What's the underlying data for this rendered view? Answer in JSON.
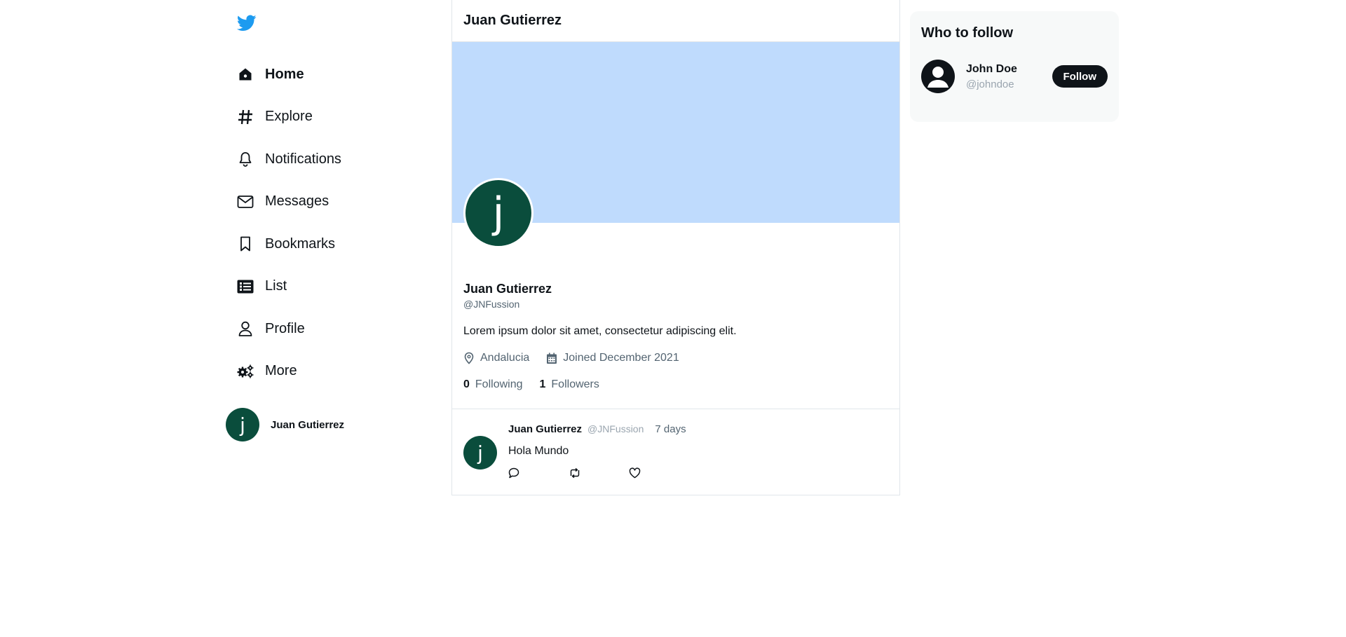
{
  "brand": {
    "color": "#1d9bf0",
    "icon": "twitter-bird-icon"
  },
  "sidebar": {
    "items": [
      {
        "label": "Home",
        "icon": "home-icon",
        "active": true
      },
      {
        "label": "Explore",
        "icon": "hashtag-icon"
      },
      {
        "label": "Notifications",
        "icon": "bell-icon"
      },
      {
        "label": "Messages",
        "icon": "envelope-icon"
      },
      {
        "label": "Bookmarks",
        "icon": "bookmark-icon"
      },
      {
        "label": "List",
        "icon": "list-icon"
      },
      {
        "label": "Profile",
        "icon": "user-icon"
      },
      {
        "label": "More",
        "icon": "gears-icon"
      }
    ],
    "account": {
      "avatar_letter": "j",
      "name": "Juan Gutierrez"
    }
  },
  "main": {
    "header_title": "Juan Gutierrez",
    "banner_color": "#bfdbfd",
    "profile": {
      "avatar_letter": "j",
      "name": "Juan Gutierrez",
      "handle": "@JNFussion",
      "bio": "Lorem ipsum dolor sit amet, consectetur adipiscing elit.",
      "location": "Andalucia",
      "joined": "Joined December 2021",
      "following_count": "0",
      "following_label": "Following",
      "followers_count": "1",
      "followers_label": "Followers"
    },
    "tweets": [
      {
        "avatar_letter": "j",
        "author": "Juan Gutierrez",
        "handle": "@JNFussion",
        "time": "7 days",
        "text": "Hola Mundo"
      }
    ]
  },
  "who_to_follow": {
    "title": "Who to follow",
    "users": [
      {
        "name": "John Doe",
        "handle": "@johndoe",
        "button_label": "Follow"
      }
    ]
  },
  "colors": {
    "avatar_bg": "#0a4d3c",
    "text_primary": "#0f1419",
    "text_secondary": "#536471"
  }
}
